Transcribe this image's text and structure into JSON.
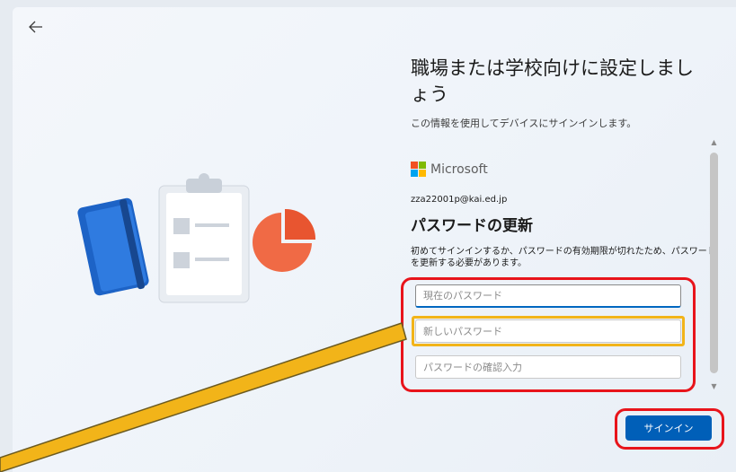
{
  "window": {
    "back_icon": "arrow-left-icon"
  },
  "page": {
    "title": "職場または学校向けに設定しましょう",
    "subtitle": "この情報を使用してデバイスにサインインします。"
  },
  "signin_frame": {
    "brand": "Microsoft",
    "brand_colors": [
      "#f25022",
      "#7fba00",
      "#00a4ef",
      "#ffb900"
    ],
    "account": "zza22001p@kai.ed.jp",
    "heading": "パスワードの更新",
    "description": "初めてサインインするか、パスワードの有効期限が切れたため、パスワードを更新する必要があります。",
    "fields": {
      "current_password": {
        "value": "",
        "placeholder": "現在のパスワード"
      },
      "new_password": {
        "value": "",
        "placeholder": "新しいパスワード"
      },
      "confirm_password": {
        "value": "",
        "placeholder": "パスワードの確認入力"
      }
    }
  },
  "footer": {
    "signin_label": "サインイン"
  },
  "annotations": {
    "highlight_color": "#e8141b",
    "pointer_color": "#f2b419"
  },
  "colors": {
    "accent": "#005fb8",
    "background": "#eef3f9"
  }
}
